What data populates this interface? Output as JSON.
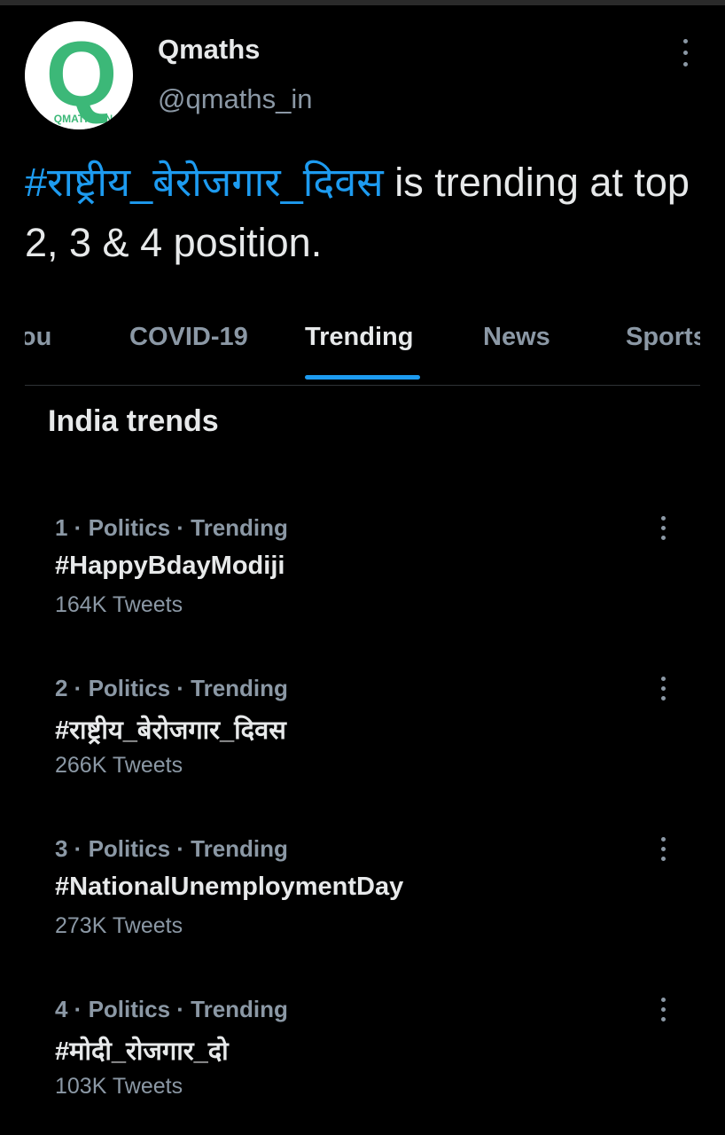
{
  "tweet": {
    "display_name": "Qmaths",
    "handle": "@qmaths_in",
    "avatar_letter": "Q",
    "avatar_caption": "QMATHS.IN",
    "avatar_color": "#3cb878",
    "hashtag": "#राष्ट्रीय_बेरोजगार_दिवस",
    "text_after_hashtag": " is trending at top 2, 3 & 4 position."
  },
  "tabs": [
    {
      "label": "For you",
      "active": false
    },
    {
      "label": "COVID-19",
      "active": false
    },
    {
      "label": "Trending",
      "active": true
    },
    {
      "label": "News",
      "active": false
    },
    {
      "label": "Sports",
      "active": false
    }
  ],
  "section_title": "India trends",
  "trends": [
    {
      "meta": "1 · Politics · Trending",
      "tag": "#HappyBdayModiji",
      "count": "164K Tweets"
    },
    {
      "meta": "2 · Politics · Trending",
      "tag": "#राष्ट्रीय_बेरोजगार_दिवस",
      "count": "266K Tweets"
    },
    {
      "meta": "3 · Politics · Trending",
      "tag": "#NationalUnemploymentDay",
      "count": "273K Tweets"
    },
    {
      "meta": "4 · Politics · Trending",
      "tag": "#मोदी_रोजगार_दो",
      "count": "103K Tweets"
    }
  ],
  "colors": {
    "background": "#000000",
    "accent": "#1d9bf0",
    "primary_text": "#e7e9ea",
    "secondary_text": "#8b98a5"
  },
  "icons": {
    "tweet_menu": "more-vertical-icon",
    "trend_menu": "more-vertical-icon"
  }
}
